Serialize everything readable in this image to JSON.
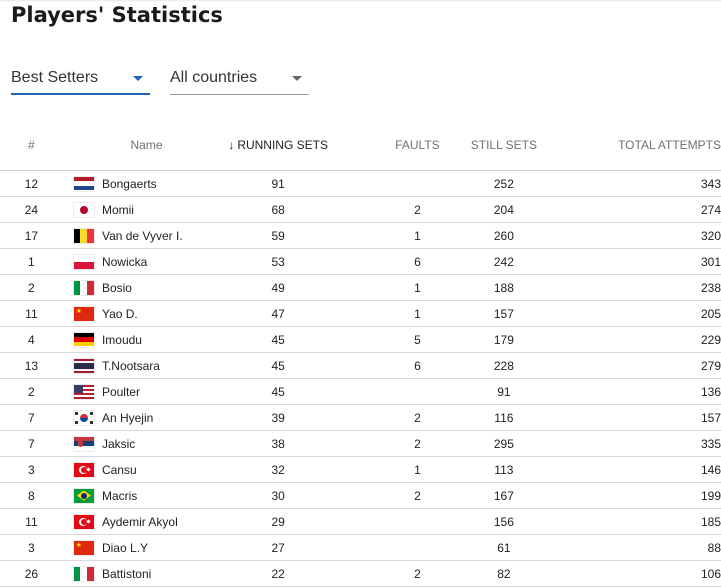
{
  "page": {
    "title": "Players' Statistics"
  },
  "filters": {
    "metric": {
      "selected": "Best Setters"
    },
    "country": {
      "selected": "All countries"
    }
  },
  "colors": {
    "accent": "#1e64b4",
    "sorted_header": "#222222",
    "header_text": "#707070"
  },
  "table": {
    "headers": {
      "rank": "#",
      "name": "Name",
      "running_sets": "RUNNING SETS",
      "faults": "FAULTS",
      "still_sets": "STILL SETS",
      "total_attempts": "TOTAL ATTEMPTS"
    },
    "sort_icon": "arrow-down-icon",
    "rows": [
      {
        "num": "12",
        "flag": "netherlands",
        "name": "Bongaerts",
        "running": "91",
        "faults": "",
        "still": "252",
        "total": "343"
      },
      {
        "num": "24",
        "flag": "japan",
        "name": "Momii",
        "running": "68",
        "faults": "2",
        "still": "204",
        "total": "274"
      },
      {
        "num": "17",
        "flag": "belgium",
        "name": "Van de Vyver I.",
        "running": "59",
        "faults": "1",
        "still": "260",
        "total": "320"
      },
      {
        "num": "1",
        "flag": "poland",
        "name": "Nowicka",
        "running": "53",
        "faults": "6",
        "still": "242",
        "total": "301"
      },
      {
        "num": "2",
        "flag": "italy",
        "name": "Bosio",
        "running": "49",
        "faults": "1",
        "still": "188",
        "total": "238"
      },
      {
        "num": "11",
        "flag": "china",
        "name": "Yao D.",
        "running": "47",
        "faults": "1",
        "still": "157",
        "total": "205"
      },
      {
        "num": "4",
        "flag": "germany",
        "name": "Imoudu",
        "running": "45",
        "faults": "5",
        "still": "179",
        "total": "229"
      },
      {
        "num": "13",
        "flag": "thailand",
        "name": "T.Nootsara",
        "running": "45",
        "faults": "6",
        "still": "228",
        "total": "279"
      },
      {
        "num": "2",
        "flag": "usa",
        "name": "Poulter",
        "running": "45",
        "faults": "",
        "still": "91",
        "total": "136"
      },
      {
        "num": "7",
        "flag": "korea",
        "name": "An Hyejin",
        "running": "39",
        "faults": "2",
        "still": "116",
        "total": "157"
      },
      {
        "num": "7",
        "flag": "serbia",
        "name": "Jaksic",
        "running": "38",
        "faults": "2",
        "still": "295",
        "total": "335"
      },
      {
        "num": "3",
        "flag": "turkey",
        "name": "Cansu",
        "running": "32",
        "faults": "1",
        "still": "113",
        "total": "146"
      },
      {
        "num": "8",
        "flag": "brazil",
        "name": "Macris",
        "running": "30",
        "faults": "2",
        "still": "167",
        "total": "199"
      },
      {
        "num": "11",
        "flag": "turkey",
        "name": "Aydemir Akyol",
        "running": "29",
        "faults": "",
        "still": "156",
        "total": "185"
      },
      {
        "num": "3",
        "flag": "china",
        "name": "Diao L.Y",
        "running": "27",
        "faults": "",
        "still": "61",
        "total": "88"
      },
      {
        "num": "26",
        "flag": "italy",
        "name": "Battistoni",
        "running": "22",
        "faults": "2",
        "still": "82",
        "total": "106"
      }
    ]
  }
}
